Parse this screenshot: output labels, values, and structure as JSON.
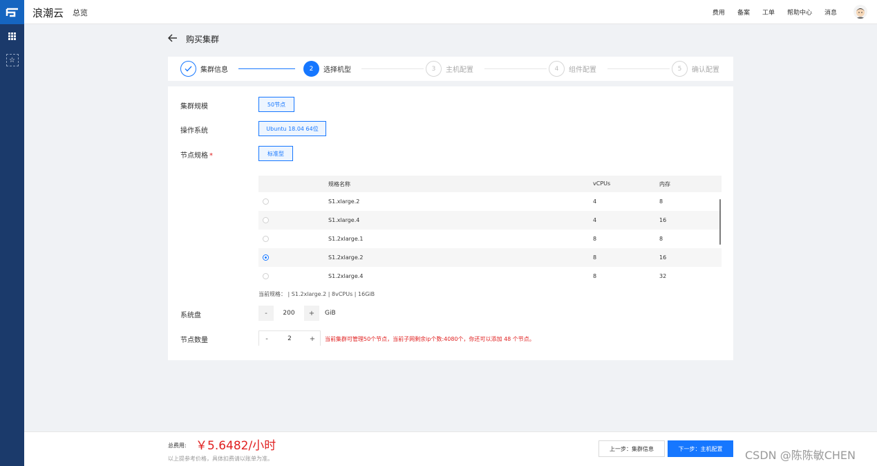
{
  "header": {
    "brand": "浪潮云",
    "overview": "总览",
    "nav": [
      "费用",
      "备案",
      "工单",
      "帮助中心",
      "消息"
    ]
  },
  "page": {
    "title": "购买集群"
  },
  "steps": [
    {
      "num": "",
      "label": "集群信息",
      "state": "done"
    },
    {
      "num": "2",
      "label": "选择机型",
      "state": "active"
    },
    {
      "num": "3",
      "label": "主机配置",
      "state": "todo"
    },
    {
      "num": "4",
      "label": "组件配置",
      "state": "todo"
    },
    {
      "num": "5",
      "label": "确认配置",
      "state": "todo"
    }
  ],
  "form": {
    "scale_label": "集群规模",
    "scale_value": "50节点",
    "os_label": "操作系统",
    "os_value": "Ubuntu 18.04 64位",
    "spec_label": "节点规格",
    "spec_required": "*",
    "spec_value": "标准型",
    "disk_label": "系统盘",
    "disk_minus": "-",
    "disk_value": "200",
    "disk_plus": "+",
    "disk_unit": "GiB",
    "count_label": "节点数量",
    "count_minus": "-",
    "count_value": "2",
    "count_plus": "+",
    "count_notice": "当前集群可管理50个节点，当前子网剩余ip个数:4080个，你还可以添加 48 个节点。",
    "current_spec": "当前规格： | S1.2xlarge.2 | 8vCPUs | 16GiB"
  },
  "table": {
    "headers": [
      "规格名称",
      "vCPUs",
      "内存"
    ],
    "rows": [
      {
        "name": "S1.xlarge.2",
        "vcpus": "4",
        "mem": "8",
        "selected": false
      },
      {
        "name": "S1.xlarge.4",
        "vcpus": "4",
        "mem": "16",
        "selected": false
      },
      {
        "name": "S1.2xlarge.1",
        "vcpus": "8",
        "mem": "8",
        "selected": false
      },
      {
        "name": "S1.2xlarge.2",
        "vcpus": "8",
        "mem": "16",
        "selected": true
      },
      {
        "name": "S1.2xlarge.4",
        "vcpus": "8",
        "mem": "32",
        "selected": false
      }
    ]
  },
  "footer": {
    "fee_label": "总费用:",
    "fee_value": "￥5.6482/小时",
    "fee_note": "以上提参考价格，具体扣费请以账单为准。",
    "prev_label": "上一步：集群信息",
    "next_label": "下一步：主机配置"
  },
  "watermark": "CSDN @陈陈敏CHEN",
  "colors": {
    "primary": "#1677ff",
    "danger": "#e02020",
    "rail": "#1b3a6b"
  }
}
